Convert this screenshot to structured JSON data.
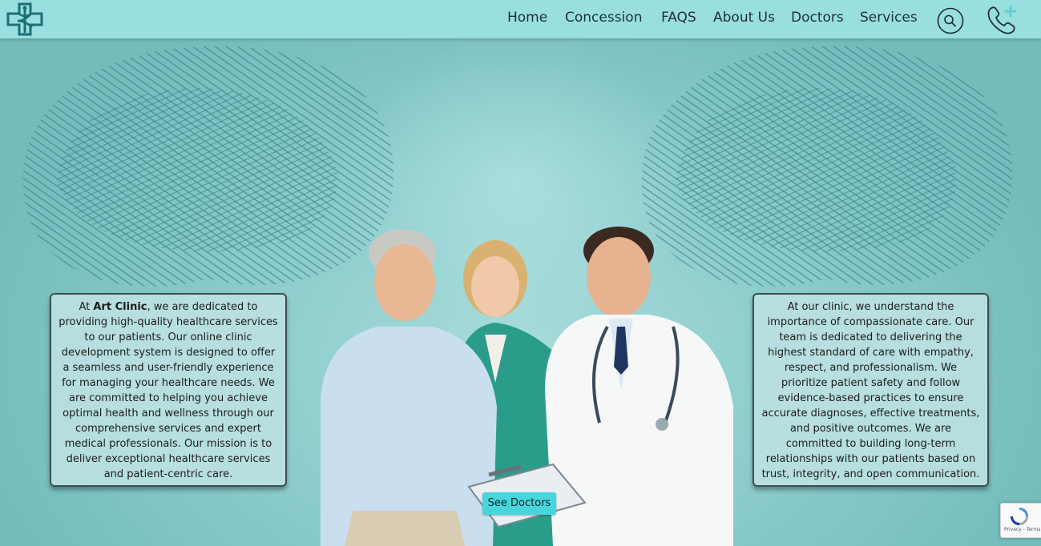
{
  "nav": {
    "items": [
      {
        "label": "Home"
      },
      {
        "label": "Concession"
      },
      {
        "label": "FAQS"
      },
      {
        "label": "About Us"
      },
      {
        "label": "Doctors"
      },
      {
        "label": "Services"
      }
    ],
    "icons": {
      "logo": "medical-cross-logo",
      "search": "search-icon",
      "phone": "phone-plus-icon"
    }
  },
  "hero": {
    "left_card": {
      "prefix": "At ",
      "brand": "Art Clinic",
      "body": ", we are dedicated to providing high-quality healthcare services to our patients. Our online clinic development system is designed to offer a seamless and user-friendly experience for managing your healthcare needs. We are committed to helping you achieve optimal health and wellness through our comprehensive services and expert medical professionals. Our mission is to deliver exceptional healthcare services and patient-centric care."
    },
    "right_card": {
      "text": "At our clinic, we understand the importance of compassionate care. Our team is dedicated to delivering the highest standard of care with empathy, respect, and professionalism. We prioritize patient safety and follow evidence-based practices to ensure accurate diagnoses, effective treatments, and positive outcomes. We are committed to building long-term relationships with our patients based on trust, integrity, and open communication."
    },
    "cta_label": "See Doctors"
  },
  "recaptcha": {
    "text": "Privacy - Terms"
  },
  "colors": {
    "navbar": "#9adfe0",
    "hero_bg": "#8ccccc",
    "button": "#47d6dc",
    "card_bg": "#bce1e1",
    "card_border": "#3e4e50",
    "logo": "#1c6f73"
  }
}
